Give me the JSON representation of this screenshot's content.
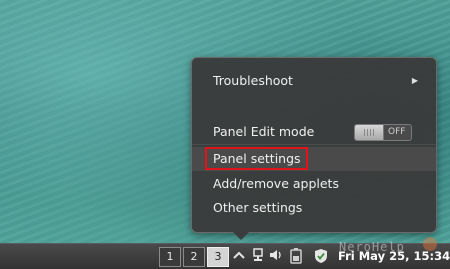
{
  "menu": {
    "troubleshoot_label": "Troubleshoot",
    "submenu_arrow": "▶",
    "panel_edit_mode_label": "Panel Edit mode",
    "panel_edit_mode_state": "OFF",
    "panel_settings_label": "Panel settings",
    "add_remove_applets_label": "Add/remove applets",
    "other_settings_label": "Other settings"
  },
  "taskbar": {
    "workspaces": [
      "1",
      "2",
      "3"
    ],
    "active_workspace": "3",
    "clock": "Fri May 25, 15:34"
  },
  "watermark": "NeroHelp",
  "icons": {
    "tray": [
      "chevron-up-icon",
      "network-icon",
      "volume-icon",
      "battery-icon",
      "shield-check-icon"
    ]
  },
  "colors": {
    "highlight_box": "#e0151b",
    "menu_bg": "#3a3a3a",
    "desktop": "#4a9c95"
  }
}
